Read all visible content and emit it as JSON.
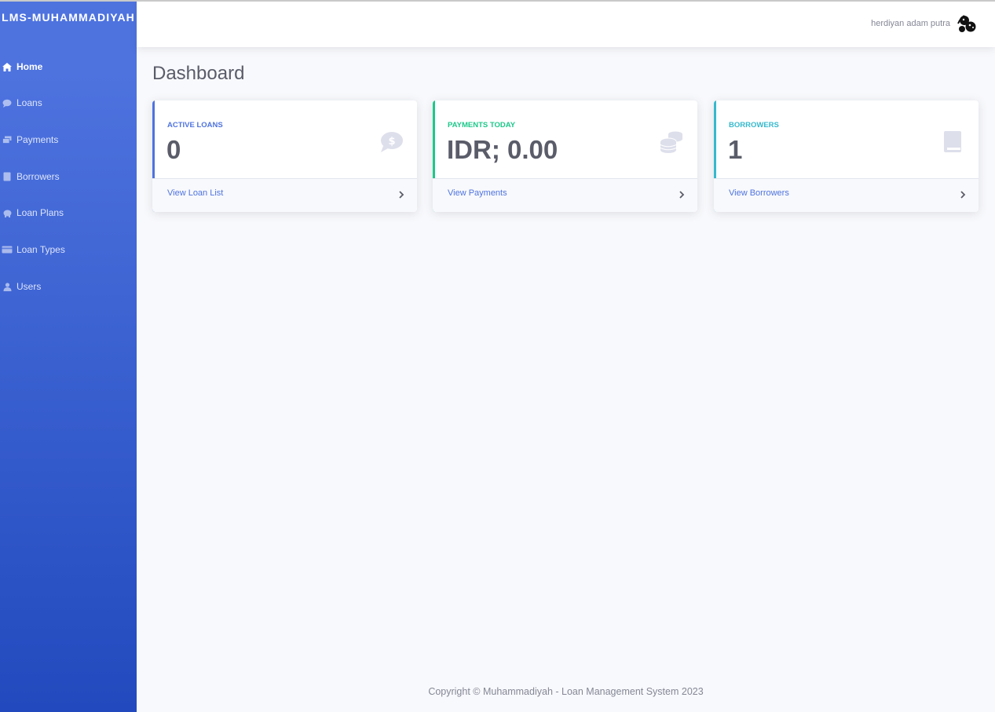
{
  "sidebar": {
    "brand": "LMS-MUHAMMADIYAH",
    "items": [
      {
        "label": "Home",
        "icon": "home-icon",
        "active": true
      },
      {
        "label": "Loans",
        "icon": "comment-dollar-icon"
      },
      {
        "label": "Payments",
        "icon": "money-bill-icon"
      },
      {
        "label": "Borrowers",
        "icon": "book-icon"
      },
      {
        "label": "Loan Plans",
        "icon": "piggy-bank-icon"
      },
      {
        "label": "Loan Types",
        "icon": "credit-card-icon"
      },
      {
        "label": "Users",
        "icon": "user-icon"
      }
    ]
  },
  "topbar": {
    "username": "herdiyan adam putra",
    "avatar_icon": "user-group-avatar-icon"
  },
  "main": {
    "page_title": "Dashboard",
    "cards": [
      {
        "label": "Active Loans",
        "value": "0",
        "link": "View Loan List",
        "color": "#4e73df",
        "icon": "comment-dollar-icon"
      },
      {
        "label": "Payments Today",
        "value": "IDR; 0.00",
        "link": "View Payments",
        "color": "#1cc88a",
        "icon": "coins-icon"
      },
      {
        "label": "Borrowers",
        "value": "1",
        "link": "View Borrowers",
        "color": "#36b9cc",
        "icon": "book-icon"
      }
    ]
  },
  "footer": {
    "copyright": "Copyright © Muhammadiyah - Loan Management System 2023"
  },
  "colors": {
    "sidebar_top": "#4e73df",
    "sidebar_bottom": "#224abe",
    "background": "#f8f9fc",
    "text_gray": "#5a5c69"
  }
}
